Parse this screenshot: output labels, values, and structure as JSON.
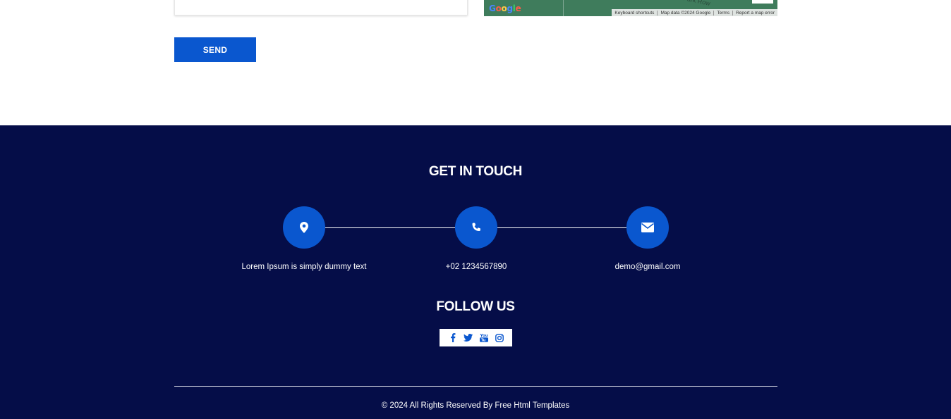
{
  "map": {
    "logo_letters": [
      "G",
      "o",
      "o",
      "g",
      "l",
      "e"
    ],
    "road_label": "Park Row",
    "attribution": [
      "Keyboard shortcuts",
      "Map data ©2024 Google",
      "Terms",
      "Report a map error"
    ]
  },
  "form": {
    "send_label": "SEND"
  },
  "footer": {
    "get_in_touch_title": "GET IN TOUCH",
    "contacts": [
      {
        "icon": "location-pin-icon",
        "text": "Lorem Ipsum is simply dummy text"
      },
      {
        "icon": "phone-icon",
        "text": "+02 1234567890"
      },
      {
        "icon": "envelope-icon",
        "text": "demo@gmail.com"
      }
    ],
    "follow_us_title": "FOLLOW US",
    "social": [
      "facebook-icon",
      "twitter-icon",
      "youtube-icon",
      "instagram-icon"
    ],
    "copyright": "© 2024 All Rights Reserved By Free Html Templates"
  },
  "colors": {
    "accent": "#0a57cf",
    "footer_bg": "#050d48",
    "white": "#ffffff"
  }
}
